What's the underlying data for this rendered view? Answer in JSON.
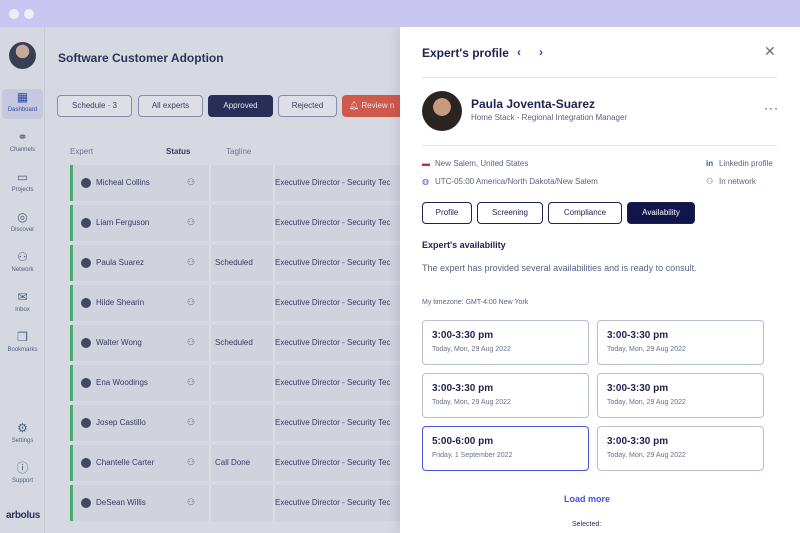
{
  "nav": {
    "items": [
      {
        "label": "Dashboard",
        "icon": "grid-icon"
      },
      {
        "label": "Channels",
        "icon": "channels-icon"
      },
      {
        "label": "Projects",
        "icon": "folder-icon"
      },
      {
        "label": "Discover",
        "icon": "discover-icon"
      },
      {
        "label": "Network",
        "icon": "network-icon"
      },
      {
        "label": "Inbox",
        "icon": "mail-icon"
      },
      {
        "label": "Bookmarks",
        "icon": "bookmark-icon"
      },
      {
        "label": "Settings",
        "icon": "gear-icon"
      },
      {
        "label": "Support",
        "icon": "help-icon"
      }
    ],
    "brand": "arbolus"
  },
  "main": {
    "title": "Software Customer Adoption",
    "filters": [
      "Schedule · 3",
      "All experts",
      "Approved",
      "Rejected",
      "Review n"
    ],
    "columns": [
      "Expert",
      "Status",
      "Tagline"
    ],
    "rows": [
      {
        "name": "Micheal Collins",
        "status": "",
        "tagline": "Executive Director - Security Tec"
      },
      {
        "name": "Liam Ferguson",
        "status": "",
        "tagline": "Executive Director - Security Tec"
      },
      {
        "name": "Paula Suarez",
        "status": "Scheduled",
        "tagline": "Executive Director - Security Tec"
      },
      {
        "name": "Hilde Shearin",
        "status": "",
        "tagline": "Executive Director - Security Tec"
      },
      {
        "name": "Walter Wong",
        "status": "Scheduled",
        "tagline": "Executive Director - Security Tec"
      },
      {
        "name": "Ena Woodings",
        "status": "",
        "tagline": "Executive Director - Security Tec"
      },
      {
        "name": "Josep Castillo",
        "status": "",
        "tagline": "Executive Director - Security Tec"
      },
      {
        "name": "Chantelle Carter",
        "status": "Call Done",
        "tagline": "Executive Director - Security Tec"
      },
      {
        "name": "DeSean Willis",
        "status": "",
        "tagline": "Executive Director - Security Tec"
      }
    ]
  },
  "panel": {
    "title": "Expert's profile",
    "expert_name": "Paula Joventa-Suarez",
    "expert_subtitle": "Home Stack - Regional Integration Manager",
    "location": "New Salem, United States",
    "timezone": "UTC-05:00 America/North Dakota/New Salem",
    "linkedin": "Linkedin profile",
    "network": "In network",
    "tabs": [
      "Profile",
      "Screening",
      "Compliance",
      "Availability"
    ],
    "active_tab": "Availability",
    "section_title": "Expert's availability",
    "section_desc": "The expert has provided several availabilities and is ready to consult.",
    "my_timezone": "My timezone: GMT-4:00 New York",
    "slots": [
      {
        "time": "3:00-3:30 pm",
        "date": "Today, Mon, 29 Aug 2022"
      },
      {
        "time": "3:00-3:30 pm",
        "date": "Today, Mon, 29 Aug 2022"
      },
      {
        "time": "3:00-3:30 pm",
        "date": "Today, Mon, 29 Aug 2022"
      },
      {
        "time": "3:00-3:30 pm",
        "date": "Today, Mon, 29 Aug 2022"
      },
      {
        "time": "5:00-6:00 pm",
        "date": "Friday, 1 September 2022"
      },
      {
        "time": "3:00-3:30 pm",
        "date": "Today, Mon, 29 Aug 2022"
      }
    ],
    "load_more": "Load more",
    "selected_label": "Selected:"
  }
}
